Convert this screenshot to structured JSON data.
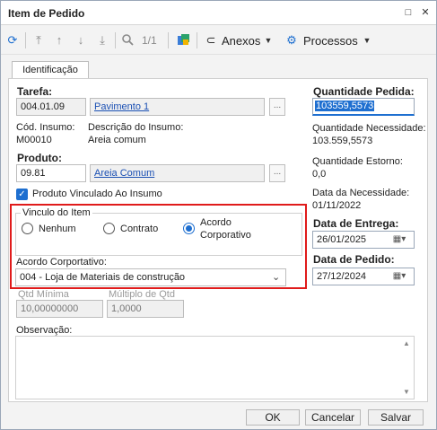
{
  "window": {
    "title": "Item de Pedido",
    "restore_glyph": "□",
    "close_glyph": "✕"
  },
  "toolbar": {
    "page_counter": "1/1",
    "anexos_label": "Anexos",
    "processos_label": "Processos",
    "icons": [
      "refresh-icon",
      "first-record-icon",
      "previous-record-icon",
      "next-record-icon",
      "last-record-icon",
      "search-icon",
      "data-icon",
      "paperclip-icon",
      "gear-icon"
    ]
  },
  "tabs": [
    {
      "label": "Identificação"
    }
  ],
  "form": {
    "tarefa_label": "Tarefa:",
    "tarefa_code": "004.01.09",
    "tarefa_name": "Pavimento 1",
    "cod_insumo_label": "Cód. Insumo:",
    "cod_insumo_value": "M00010",
    "desc_insumo_label": "Descrição do Insumo:",
    "desc_insumo_value": "Areia comum",
    "produto_label": "Produto:",
    "produto_code": "09.81",
    "produto_name": "Areia Comum",
    "dots": "...",
    "produto_vinculado_label": "Produto Vinculado Ao Insumo",
    "vinculo_label": "Vinculo do Item",
    "vinculo_options": [
      "Nenhum",
      "Contrato",
      "Acordo",
      "Corporativo"
    ],
    "acordo_label": "Acordo Corportativo:",
    "acordo_value": "004 - Loja de Materiais de construção",
    "qtd_minima_label": "Qtd Mínima",
    "qtd_minima_value": "10,00000000",
    "multiplo_label": "Múltiplo de Qtd",
    "multiplo_value": "1,0000",
    "observacao_label": "Observação:"
  },
  "right": {
    "qtd_pedida_label": "Quantidade Pedida:",
    "qtd_pedida_value": "103559,5573",
    "qtd_necessidade_label": "Quantidade Necessidade:",
    "qtd_necessidade_value": "103.559,5573",
    "qtd_estorno_label": "Quantidade Estorno:",
    "qtd_estorno_value": "0,0",
    "data_necessidade_label": "Data da Necessidade:",
    "data_necessidade_value": "01/11/2022",
    "data_entrega_label": "Data de Entrega:",
    "data_entrega_value": "26/01/2025",
    "data_pedido_label": "Data de Pedido:",
    "data_pedido_value": "27/12/2024"
  },
  "footer": {
    "ok_label": "OK",
    "cancel_label": "Cancelar",
    "save_label": "Salvar"
  },
  "colors": {
    "accent": "#1e6fd0",
    "highlight": "#e01b1b",
    "link": "#1a4fb3"
  }
}
